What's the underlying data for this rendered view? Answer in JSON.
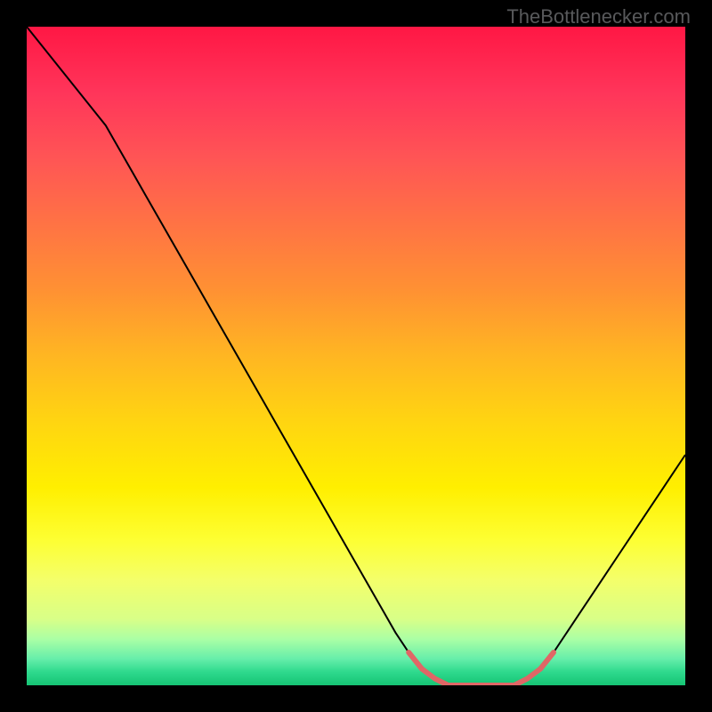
{
  "watermark": "TheBottlenecker.com",
  "chart_data": {
    "type": "line",
    "title": "",
    "xlabel": "",
    "ylabel": "",
    "xlim": [
      0,
      100
    ],
    "ylim": [
      0,
      100
    ],
    "curve": [
      {
        "x": 0,
        "y": 100
      },
      {
        "x": 2,
        "y": 97.5
      },
      {
        "x": 4,
        "y": 95
      },
      {
        "x": 6,
        "y": 92.5
      },
      {
        "x": 8,
        "y": 90
      },
      {
        "x": 10,
        "y": 87.5
      },
      {
        "x": 12,
        "y": 85
      },
      {
        "x": 14,
        "y": 81.5
      },
      {
        "x": 16,
        "y": 78
      },
      {
        "x": 18,
        "y": 74.5
      },
      {
        "x": 20,
        "y": 71
      },
      {
        "x": 22,
        "y": 67.5
      },
      {
        "x": 24,
        "y": 64
      },
      {
        "x": 26,
        "y": 60.5
      },
      {
        "x": 28,
        "y": 57
      },
      {
        "x": 30,
        "y": 53.5
      },
      {
        "x": 32,
        "y": 50
      },
      {
        "x": 34,
        "y": 46.5
      },
      {
        "x": 36,
        "y": 43
      },
      {
        "x": 38,
        "y": 39.5
      },
      {
        "x": 40,
        "y": 36
      },
      {
        "x": 42,
        "y": 32.5
      },
      {
        "x": 44,
        "y": 29
      },
      {
        "x": 46,
        "y": 25.5
      },
      {
        "x": 48,
        "y": 22
      },
      {
        "x": 50,
        "y": 18.5
      },
      {
        "x": 52,
        "y": 15
      },
      {
        "x": 54,
        "y": 11.5
      },
      {
        "x": 56,
        "y": 8
      },
      {
        "x": 58,
        "y": 5
      },
      {
        "x": 60,
        "y": 2.5
      },
      {
        "x": 62,
        "y": 1
      },
      {
        "x": 64,
        "y": 0
      },
      {
        "x": 66,
        "y": 0
      },
      {
        "x": 68,
        "y": 0
      },
      {
        "x": 70,
        "y": 0
      },
      {
        "x": 72,
        "y": 0
      },
      {
        "x": 74,
        "y": 0
      },
      {
        "x": 76,
        "y": 1
      },
      {
        "x": 78,
        "y": 2.5
      },
      {
        "x": 80,
        "y": 5
      },
      {
        "x": 82,
        "y": 8
      },
      {
        "x": 84,
        "y": 11
      },
      {
        "x": 86,
        "y": 14
      },
      {
        "x": 88,
        "y": 17
      },
      {
        "x": 90,
        "y": 20
      },
      {
        "x": 92,
        "y": 23
      },
      {
        "x": 94,
        "y": 26
      },
      {
        "x": 96,
        "y": 29
      },
      {
        "x": 98,
        "y": 32
      },
      {
        "x": 100,
        "y": 35
      }
    ],
    "min_zone": {
      "x_start": 60,
      "x_end": 78
    },
    "gradient_stops": [
      {
        "pct": 0,
        "color": "#ff1744"
      },
      {
        "pct": 10,
        "color": "#ff355a"
      },
      {
        "pct": 20,
        "color": "#ff5555"
      },
      {
        "pct": 30,
        "color": "#ff7344"
      },
      {
        "pct": 40,
        "color": "#ff9133"
      },
      {
        "pct": 50,
        "color": "#ffb622"
      },
      {
        "pct": 60,
        "color": "#ffd511"
      },
      {
        "pct": 70,
        "color": "#ffef00"
      },
      {
        "pct": 78,
        "color": "#fdff33"
      },
      {
        "pct": 84,
        "color": "#f4ff6a"
      },
      {
        "pct": 90,
        "color": "#d8ff88"
      },
      {
        "pct": 93,
        "color": "#aaffa5"
      },
      {
        "pct": 96,
        "color": "#66eeaa"
      },
      {
        "pct": 98,
        "color": "#2ed98d"
      },
      {
        "pct": 100,
        "color": "#16c474"
      }
    ],
    "accent_color": "#e06666"
  }
}
